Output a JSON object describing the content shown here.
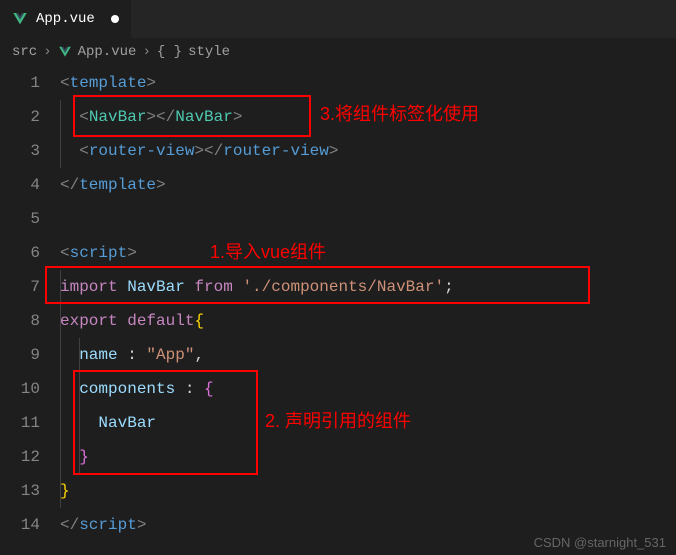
{
  "tab": {
    "title": "App.vue"
  },
  "breadcrumb": {
    "folder": "src",
    "file": "App.vue",
    "symbol": "style"
  },
  "lines": [
    "1",
    "2",
    "3",
    "4",
    "5",
    "6",
    "7",
    "8",
    "9",
    "10",
    "11",
    "12",
    "13",
    "14"
  ],
  "code": {
    "l1": {
      "open": "<",
      "tag": "template",
      "close": ">"
    },
    "l2": {
      "open": "<",
      "name": "NavBar",
      "mid": "></",
      "close": ">"
    },
    "l3": {
      "open": "<",
      "tag": "router-view",
      "mid": "></",
      "close": ">"
    },
    "l4": {
      "open": "</",
      "tag": "template",
      "close": ">"
    },
    "l6": {
      "open": "<",
      "tag": "script",
      "close": ">"
    },
    "l7": {
      "import": "import",
      "name": "NavBar",
      "from": "from",
      "path": "'./components/NavBar'",
      "semi": ";"
    },
    "l8": {
      "export": "export",
      "default": "default",
      "brace": "{"
    },
    "l9": {
      "key": "name",
      "colon": " : ",
      "val": "\"App\"",
      "comma": ","
    },
    "l10": {
      "key": "components",
      "colon": " : ",
      "brace": "{"
    },
    "l11": {
      "name": "NavBar"
    },
    "l12": {
      "brace": "}"
    },
    "l13": {
      "brace": "}"
    },
    "l14": {
      "open": "</",
      "tag": "script",
      "close": ">"
    }
  },
  "annotations": {
    "a1": "1.导入vue组件",
    "a2": "2. 声明引用的组件",
    "a3": "3.将组件标签化使用"
  },
  "watermark": "CSDN @starnight_531"
}
